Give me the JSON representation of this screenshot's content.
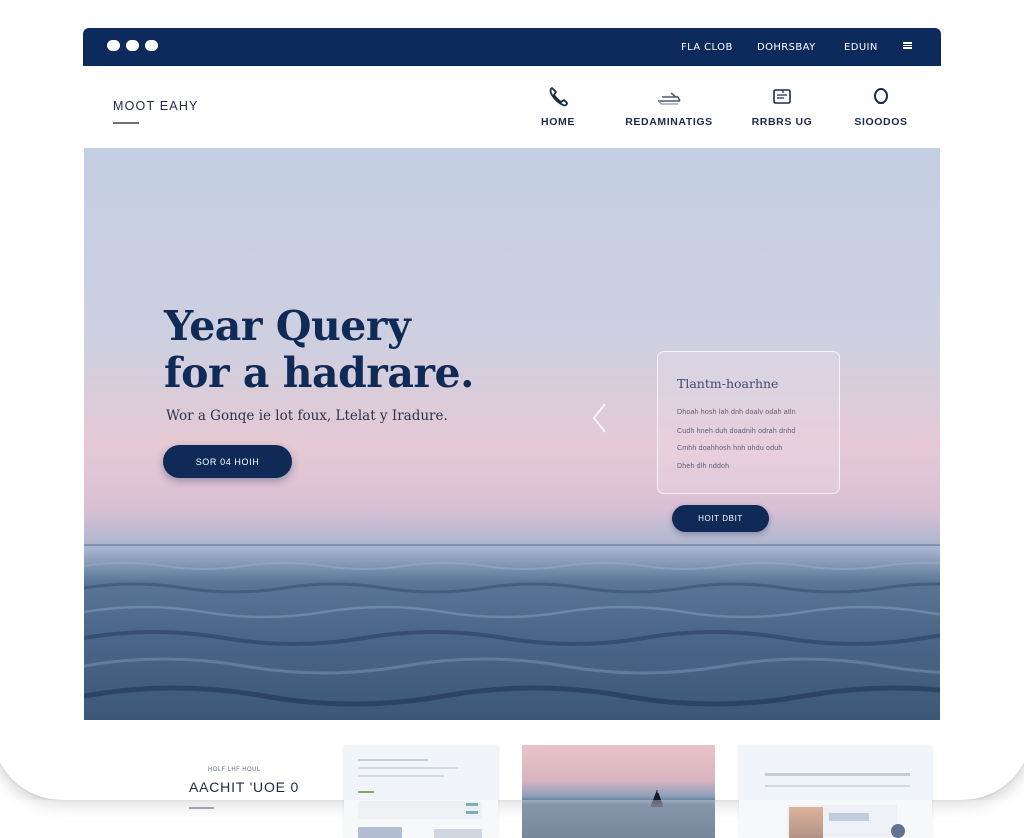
{
  "window": {
    "topnav": [
      "FLA CLOB",
      "DOHRSBAY",
      "EDUIN"
    ]
  },
  "header": {
    "brand": "MOOT EAHY",
    "nav": [
      {
        "label": "HOME",
        "icon": "phone-icon"
      },
      {
        "label": "REDAMINATIGS",
        "icon": "airplane-icon"
      },
      {
        "label": "RRBRS UG",
        "icon": "document-icon"
      },
      {
        "label": "SIOODOS",
        "icon": "circle-icon"
      }
    ]
  },
  "hero": {
    "title_line1": "Year Query",
    "title_line2": "for a hadrare.",
    "subtitle": "Wor a Gonqe ie lot foux, Ltelat y Iradure.",
    "cta_label": "SOR 04 HOIH",
    "card": {
      "title": "Tlantm-hoarhne",
      "lines": [
        "Dhoah hosh lah dnh doalv odah atln",
        "Cudh hneh duh doadnih odrah dnhd",
        "Cmhh doahhosh hnh ohdu oduh",
        "Dheh dlh nddoh"
      ],
      "button_label": "HOIT DBIT"
    }
  },
  "section": {
    "eyebrow": "HOLF LHF HOUL",
    "title": "AACHIT 'UOE 0"
  },
  "colors": {
    "navy": "#0d2a5c",
    "sky_top": "#c3cfe3",
    "sky_pink": "#e6c9d4",
    "sea": "#4a6789"
  }
}
